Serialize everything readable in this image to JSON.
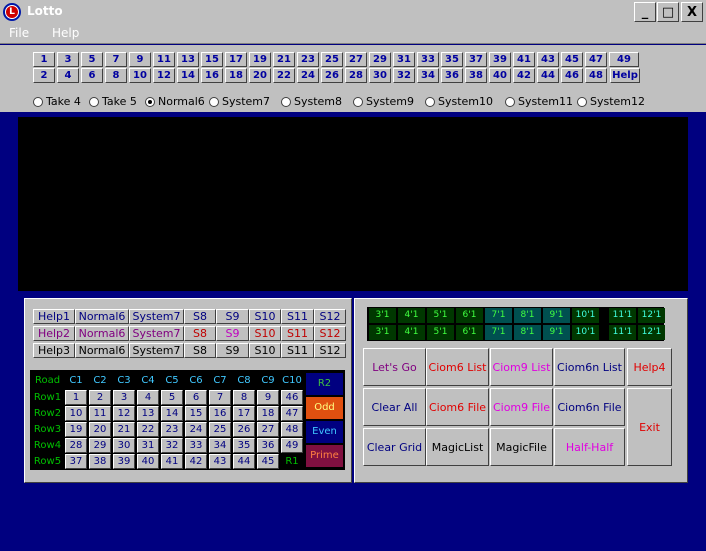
{
  "window": {
    "title": "Lotto",
    "logo_letter": "L",
    "minimize": "_",
    "maximize": "□",
    "close": "X"
  },
  "menu": [
    {
      "label": "File"
    },
    {
      "label": "Help"
    }
  ],
  "numbers": {
    "row1": [
      "1",
      "3",
      "5",
      "7",
      "9",
      "11",
      "13",
      "15",
      "17",
      "19",
      "21",
      "23",
      "25",
      "27",
      "29",
      "31",
      "33",
      "35",
      "37",
      "39",
      "41",
      "43",
      "45",
      "47",
      "49"
    ],
    "row2": [
      "2",
      "4",
      "6",
      "8",
      "10",
      "12",
      "14",
      "16",
      "18",
      "20",
      "22",
      "24",
      "26",
      "28",
      "30",
      "32",
      "34",
      "36",
      "38",
      "40",
      "42",
      "44",
      "46",
      "48"
    ],
    "help": "Help"
  },
  "modes": [
    {
      "label": "Take 4",
      "selected": false
    },
    {
      "label": "Take 5",
      "selected": false
    },
    {
      "label": "Normal6",
      "selected": true
    },
    {
      "label": "System7",
      "selected": false
    },
    {
      "label": "System8",
      "selected": false
    },
    {
      "label": "System9",
      "selected": false
    },
    {
      "label": "System10",
      "selected": false
    },
    {
      "label": "System11",
      "selected": false
    },
    {
      "label": "System12",
      "selected": false
    }
  ],
  "help_rows": [
    {
      "cells": [
        "Help1",
        "Normal6",
        "System7",
        "S8",
        "S9",
        "S10",
        "S11",
        "S12"
      ],
      "colors": [
        "#000080",
        "#000080",
        "#000080",
        "#000080",
        "#000080",
        "#000080",
        "#000080",
        "#000080"
      ]
    },
    {
      "cells": [
        "Help2",
        "Normal6",
        "System7",
        "S8",
        "S9",
        "S10",
        "S11",
        "S12"
      ],
      "colors": [
        "#800080",
        "#800080",
        "#800080",
        "#c00000",
        "#c000c0",
        "#c00000",
        "#c00000",
        "#c00000"
      ]
    },
    {
      "cells": [
        "Help3",
        "Normal6",
        "System7",
        "S8",
        "S9",
        "S10",
        "S11",
        "S12"
      ],
      "colors": [
        "#000000",
        "#000000",
        "#000000",
        "#000000",
        "#000000",
        "#000000",
        "#000000",
        "#000000"
      ]
    }
  ],
  "grid": {
    "corner": "Road",
    "columns": [
      "C1",
      "C2",
      "C3",
      "C4",
      "C5",
      "C6",
      "C7",
      "C8",
      "C9",
      "C10"
    ],
    "rows": [
      {
        "label": "Row1",
        "values": [
          "1",
          "2",
          "3",
          "4",
          "5",
          "6",
          "7",
          "8",
          "9",
          "46"
        ]
      },
      {
        "label": "Row2",
        "values": [
          "10",
          "11",
          "12",
          "13",
          "14",
          "15",
          "16",
          "17",
          "18",
          "47"
        ]
      },
      {
        "label": "Row3",
        "values": [
          "19",
          "20",
          "21",
          "22",
          "23",
          "24",
          "25",
          "26",
          "27",
          "48"
        ]
      },
      {
        "label": "Row4",
        "values": [
          "28",
          "29",
          "30",
          "31",
          "32",
          "33",
          "34",
          "35",
          "36",
          "49"
        ]
      },
      {
        "label": "Row5",
        "values": [
          "37",
          "38",
          "39",
          "40",
          "41",
          "42",
          "43",
          "44",
          "45",
          "R1"
        ]
      }
    ],
    "side": [
      "R2",
      "Odd",
      "Even",
      "Prime"
    ]
  },
  "results": {
    "row1": [
      "3'1",
      "4'1",
      "5'1",
      "6'1",
      "7'1",
      "8'1",
      "9'1",
      "10'1",
      "11'1",
      "12'1"
    ],
    "row2": [
      "3'1",
      "4'1",
      "5'1",
      "6'1",
      "7'1",
      "8'1",
      "9'1",
      "10'1",
      "11'1",
      "12'1"
    ]
  },
  "actions": [
    {
      "label": "Let's Go",
      "color": "#800080"
    },
    {
      "label": "Ciom6 List",
      "color": "#e00000"
    },
    {
      "label": "Ciom9 List",
      "color": "#e000e0"
    },
    {
      "label": "Ciom6n List",
      "color": "#000080"
    },
    {
      "label": "Help4",
      "color": "#e00000"
    },
    {
      "label": "Clear All",
      "color": "#000080"
    },
    {
      "label": "Ciom6 File",
      "color": "#e00000"
    },
    {
      "label": "Ciom9 File",
      "color": "#e000e0"
    },
    {
      "label": "Ciom6n File",
      "color": "#000080"
    },
    {
      "label": "Exit",
      "color": "#e00000"
    },
    {
      "label": "Clear Grid",
      "color": "#000080"
    },
    {
      "label": "MagicList",
      "color": "#000000"
    },
    {
      "label": "MagicFile",
      "color": "#000000"
    },
    {
      "label": "Half-Half",
      "color": "#e000e0"
    }
  ],
  "colors": {
    "background": "#000080",
    "panel": "#c0c0c0",
    "display": "#000000"
  }
}
